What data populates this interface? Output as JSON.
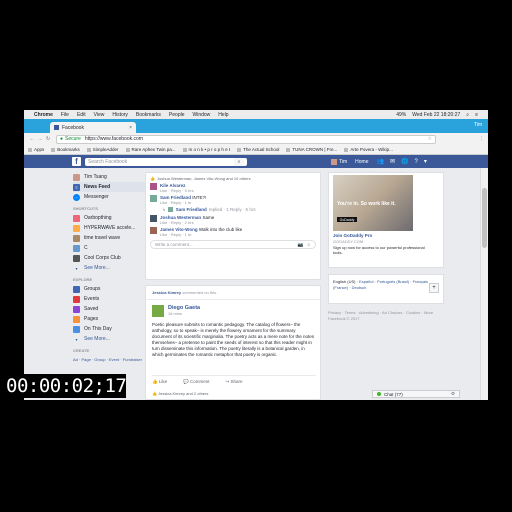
{
  "menubar": {
    "app": "Chrome",
    "items": [
      "File",
      "Edit",
      "View",
      "History",
      "Bookmarks",
      "People",
      "Window",
      "Help"
    ],
    "battery": "49%",
    "clock": "Wed Feb 22  18:20:27"
  },
  "tab": {
    "title": "Facebook",
    "user": "Tim"
  },
  "address": {
    "secure_label": "Secure",
    "url": "https://www.facebook.com"
  },
  "bookmarks": [
    "Apps",
    "Bookmarks",
    "SimpleAdder",
    "Rare Aphex Twin pa...",
    "m o n k • p r o p h e t",
    "The Actual School",
    "TUNA CROWN | Fre...",
    "Arte Povera - Wikip..."
  ],
  "fbbar": {
    "search_placeholder": "Search Facebook",
    "user": "Tim",
    "home": "Home"
  },
  "leftnav": {
    "profile": "Tim Tsang",
    "top": [
      {
        "label": "News Feed",
        "icon": "news-feed-icon",
        "selected": true
      },
      {
        "label": "Messenger",
        "icon": "messenger-icon",
        "selected": false
      }
    ],
    "shortcuts_heading": "SHORTCUTS",
    "shortcuts": [
      {
        "label": "Oarbopthing",
        "icon": "group-icon"
      },
      {
        "label": "HYPERWAVE accele...",
        "icon": "group-icon"
      },
      {
        "label": "time travel wave",
        "icon": "group-icon"
      },
      {
        "label": "C",
        "icon": "group-icon"
      },
      {
        "label": "Cool Corps Club",
        "icon": "group-icon"
      }
    ],
    "see_more": "See More...",
    "explore_heading": "EXPLORE",
    "explore": [
      {
        "label": "Groups",
        "icon": "groups-icon"
      },
      {
        "label": "Events",
        "icon": "events-icon"
      },
      {
        "label": "Saved",
        "icon": "saved-icon"
      },
      {
        "label": "Pages",
        "icon": "pages-icon"
      },
      {
        "label": "On This Day",
        "icon": "on-this-day-icon"
      },
      {
        "label": "See More...",
        "icon": "see-more-icon"
      }
    ],
    "create_heading": "CREATE",
    "create_links": "Ad · Page · Group · Event · Fundraiser"
  },
  "feed": {
    "card1": {
      "reactions": "Joshua Westerman, James Vito-Wong and 10 others",
      "comments": [
        {
          "name": "Kile Alvarez",
          "text": "",
          "meta": "Like · Reply · 5 hrs"
        },
        {
          "name": "Sam Friedland",
          "text": "INTE?!",
          "meta": "Like · Reply · 1 hr"
        },
        {
          "name": "Sam Friedland",
          "text": "replied · 1 Reply · 5 hrs",
          "meta": ""
        },
        {
          "name": "Joshua Westerman",
          "text": "Same",
          "meta": "Like · Reply · 2 hrs"
        },
        {
          "name": "James Vito-Wong",
          "text": "Walk into the club like",
          "meta": "Like · Reply · 1 hr"
        }
      ],
      "comment_placeholder": "Write a comment..."
    },
    "card2": {
      "commented_by": "Jessica Kimrey",
      "commented_suffix": "commented on this.",
      "author": "Diego Gaeta",
      "time": "16 mins",
      "text": "Poetic pleasure submits to romantic pedagogy. The catalog of flowers– the anthology, so to speak– is merely the flowery ornament for the summary document of its scientific marginalia. The poetry acts as a mere note for the notes themselves– a pretense to paint the seeds of interest so that this reader might in turn disseminate this information. The poetry literally is a botanical garden, in which germinates the romantic metaphor that poetry is organic.",
      "actions": [
        "Like",
        "Comment",
        "Share"
      ],
      "likes": "Jessica Kimrey and 2 others"
    }
  },
  "rightcol": {
    "ad_tagline": "You're in. So work like it.",
    "ad_badge": "GoDaddy",
    "ad_title": "Join GoDaddy Pro",
    "ad_url": "GODADDY.COM",
    "ad_desc": "Sign up now for access to our powerful professional tools.",
    "lang_current": "English (US) ·",
    "lang_alternatives": "Español · Português (Brasil) · Français (France) · Deutsch",
    "footer_links": "Privacy · Terms · Advertising · Ad Choices · Cookies · More",
    "copyright": "Facebook © 2017"
  },
  "chat": {
    "label": "Chat (77)"
  },
  "overlay": {
    "timecode": "00:00:02;17"
  },
  "colors": {
    "fb_blue": "#3b5998",
    "tab_bar": "#2aa3dc",
    "link": "#365899"
  }
}
